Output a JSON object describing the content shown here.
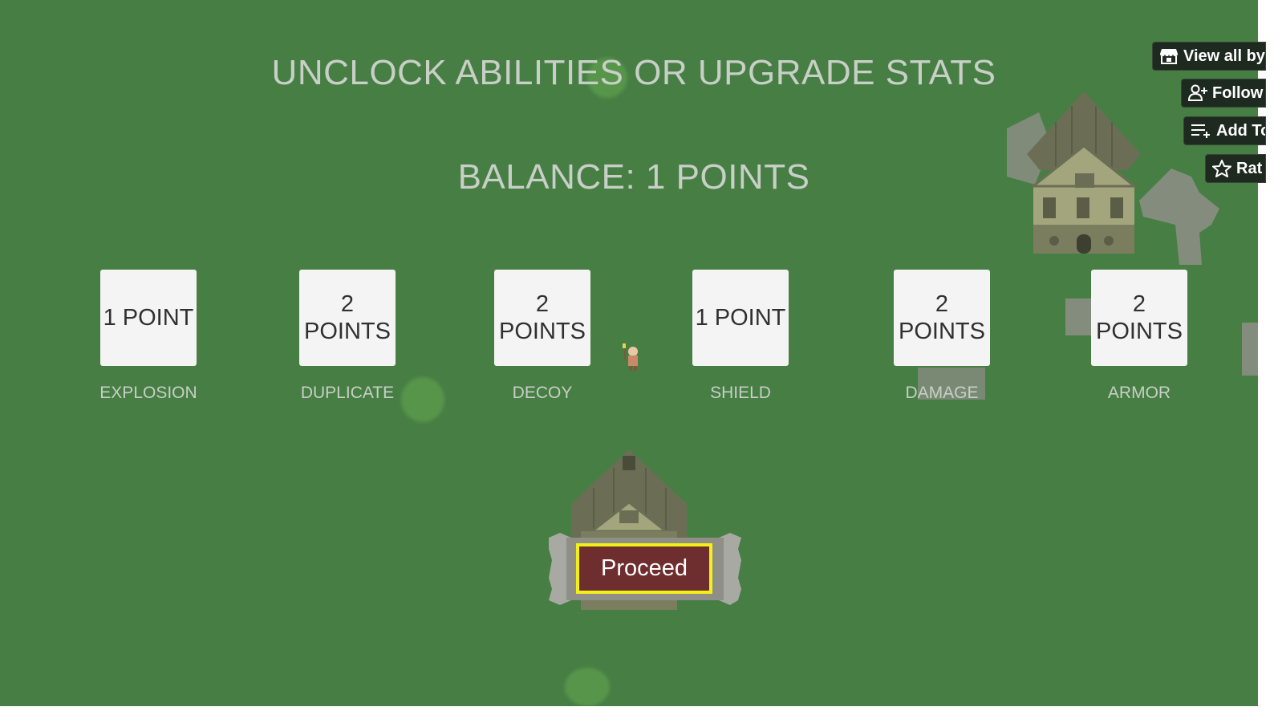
{
  "header": {
    "title": "UNCLOCK ABILITIES OR UPGRADE STATS",
    "balance": "BALANCE: 1 POINTS"
  },
  "abilities": [
    {
      "cost_line1": "1 POINT",
      "cost_line2": "",
      "name": "EXPLOSION"
    },
    {
      "cost_line1": "2",
      "cost_line2": "POINTS",
      "name": "DUPLICATE"
    },
    {
      "cost_line1": "2",
      "cost_line2": "POINTS",
      "name": "DECOY"
    },
    {
      "cost_line1": "1 POINT",
      "cost_line2": "",
      "name": "SHIELD"
    },
    {
      "cost_line1": "2",
      "cost_line2": "POINTS",
      "name": "DAMAGE"
    },
    {
      "cost_line1": "2",
      "cost_line2": "POINTS",
      "name": "ARMOR"
    }
  ],
  "proceed": {
    "label": "Proceed"
  },
  "itch_toolbar": {
    "view_all": "View all by",
    "follow": "Follow",
    "add_to": "Add To",
    "rate": "Rat"
  },
  "colors": {
    "grass": "#477e44",
    "card": "#f4f4f4",
    "proceed_fill": "#6e2d2f",
    "proceed_border": "#f3f018",
    "text_muted": "#c7cfc6"
  }
}
